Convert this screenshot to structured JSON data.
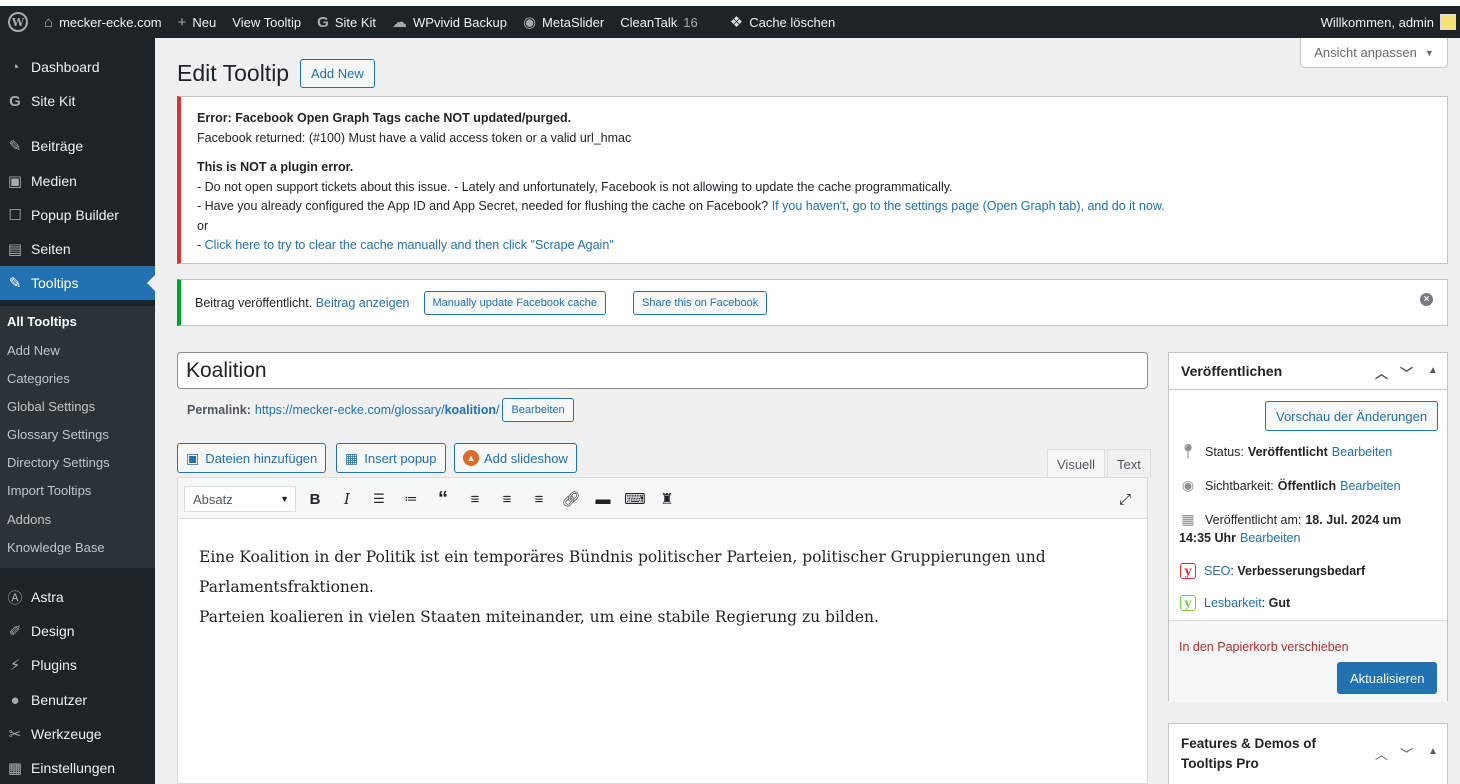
{
  "adminbar": {
    "site": "mecker-ecke.com",
    "new": "Neu",
    "view_tooltip": "View Tooltip",
    "site_kit": "Site Kit",
    "wpvivid": "WPvivid Backup",
    "metaslider": "MetaSlider",
    "cleantalk": "CleanTalk",
    "cleantalk_count": "16",
    "cache": "Cache löschen",
    "welcome": "Willkommen, admin"
  },
  "sidebar": {
    "items": [
      {
        "label": "Dashboard",
        "icon": "dashboard-icon"
      },
      {
        "label": "Site Kit",
        "icon": "site-kit-icon"
      },
      {
        "label": "Beiträge",
        "icon": "pin-icon"
      },
      {
        "label": "Medien",
        "icon": "media-icon"
      },
      {
        "label": "Popup Builder",
        "icon": "popup-icon"
      },
      {
        "label": "Seiten",
        "icon": "pages-icon"
      },
      {
        "label": "Tooltips",
        "icon": "pin-icon"
      },
      {
        "label": "Astra",
        "icon": "astra-icon"
      },
      {
        "label": "Design",
        "icon": "brush-icon"
      },
      {
        "label": "Plugins",
        "icon": "plugin-icon"
      },
      {
        "label": "Benutzer",
        "icon": "user-icon"
      },
      {
        "label": "Werkzeuge",
        "icon": "wrench-icon"
      },
      {
        "label": "Einstellungen",
        "icon": "settings-icon"
      }
    ],
    "submenu": [
      "All Tooltips",
      "Add New",
      "Categories",
      "Global Settings",
      "Glossary Settings",
      "Directory Settings",
      "Import Tooltips",
      "Addons",
      "Knowledge Base"
    ]
  },
  "screen_options": "Ansicht anpassen",
  "page": {
    "title": "Edit Tooltip",
    "add_new": "Add New"
  },
  "error_notice": {
    "heading": "Error: Facebook Open Graph Tags cache NOT updated/purged.",
    "line1": "Facebook returned: (#100) Must have a valid access token or a valid url_hmac",
    "heading2": "This is NOT a plugin error.",
    "line2": "- Do not open support tickets about this issue. - Lately and unfortunately, Facebook is not allowing to update the cache programmatically.",
    "line3_prefix": "- Have you already configured the App ID and App Secret, needed for flushing the cache on Facebook?",
    "line3_link": "If you haven't, go to the settings page (Open Graph tab), and do it now.",
    "line4": "or",
    "line5_prefix": "- ",
    "line5_link": "Click here to try to clear the cache manually and then click \"Scrape Again\""
  },
  "success_notice": {
    "text": "Beitrag veröffentlicht.",
    "link": "Beitrag anzeigen",
    "btn1": "Manually update Facebook cache",
    "btn2": "Share this on Facebook"
  },
  "post": {
    "title": "Koalition",
    "permalink_label": "Permalink:",
    "permalink_base": "https://mecker-ecke.com/glossary/",
    "permalink_slug": "koalition",
    "permalink_end": "/",
    "edit_btn": "Bearbeiten"
  },
  "media_buttons": {
    "add_media": "Dateien hinzufügen",
    "insert_popup": "Insert popup",
    "add_slideshow": "Add slideshow"
  },
  "editor": {
    "tab_visual": "Visuell",
    "tab_text": "Text",
    "format": "Absatz",
    "content_line1": "Eine Koalition in der Politik ist ein temporäres Bündnis politischer Parteien, politischer Gruppierungen und Parlamentsfraktionen.",
    "content_line2": "Parteien koalieren in vielen Staaten miteinander, um eine stabile Regierung zu bilden."
  },
  "publish": {
    "title": "Veröffentlichen",
    "preview": "Vorschau der Änderungen",
    "status_label": "Status:",
    "status_value": "Veröffentlicht",
    "visibility_label": "Sichtbarkeit:",
    "visibility_value": "Öffentlich",
    "published_label": "Veröffentlicht am:",
    "published_value": "18. Jul. 2024 um",
    "published_time": "14:35 Uhr",
    "edit": "Bearbeiten",
    "seo_label": "SEO",
    "seo_value": "Verbesserungsbedarf",
    "read_label": "Lesbarkeit",
    "read_value": "Gut",
    "trash": "In den Papierkorb verschieben",
    "update": "Aktualisieren"
  },
  "features_box": {
    "title_line1": "Features & Demos of",
    "title_line2": "Tooltips Pro"
  }
}
